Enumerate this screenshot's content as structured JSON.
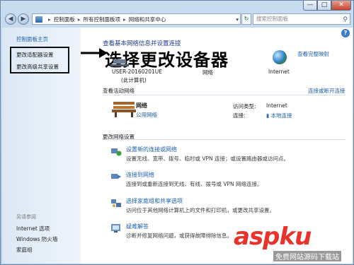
{
  "window": {
    "minimize": "—",
    "maximize": "□",
    "close": "✕"
  },
  "address_bar": {
    "back": "◀",
    "forward": "▶",
    "crumbs": [
      "控制面板",
      "所有控制面板项",
      "网络和共享中心"
    ],
    "refresh": "↻",
    "search_placeholder": "搜索控制面板"
  },
  "sidebar": {
    "home": "控制面板主页",
    "change_adapter": "更改适配器设置",
    "change_advanced": "更改高级共享设置",
    "see_also": "另请参阅",
    "internet_options": "Internet 选项",
    "firewall": "Windows 防火墙",
    "homegroup": "家庭组"
  },
  "main": {
    "heading": "查看基本网络信息并设置连接",
    "annotation": "选择更改设备器",
    "full_map": "查看完整映射",
    "computer_name": "USER-20160201UE",
    "computer_sub": "(此计算机)",
    "network_label": "网络",
    "internet_label": "Internet",
    "active_networks": "查看活动网络",
    "connect_disconnect": "连接或断开连接",
    "network_name": "网络",
    "network_type": "公用网络",
    "access_type_label": "访问类型:",
    "access_type_value": "Internet",
    "connections_label": "连接:",
    "connections_value": "本地连接",
    "change_settings": "更改网络设置",
    "tasks": [
      {
        "title": "设置新的连接或网络",
        "desc": "设置无线、宽带、拨号、临时或 VPN 连接；或设置路由器或访问点。"
      },
      {
        "title": "连接到网络",
        "desc": "连接到或重新连接到无线、有线、拨号或 VPN 网络连接。"
      },
      {
        "title": "选择家庭组和共享选项",
        "desc": "访问位于其他网络计算机上的文件和打印机，或更改共享设置。"
      },
      {
        "title": "疑难解答",
        "desc": "诊断并修复网络问题，或获得故障排除信息。"
      }
    ]
  },
  "watermark": {
    "brand": "aspku",
    "sub": "免费网站源码下载站"
  },
  "colors": {
    "link": "#1b5fb0",
    "watermark_red": "#e8322a",
    "chrome": "#c9dcef"
  }
}
